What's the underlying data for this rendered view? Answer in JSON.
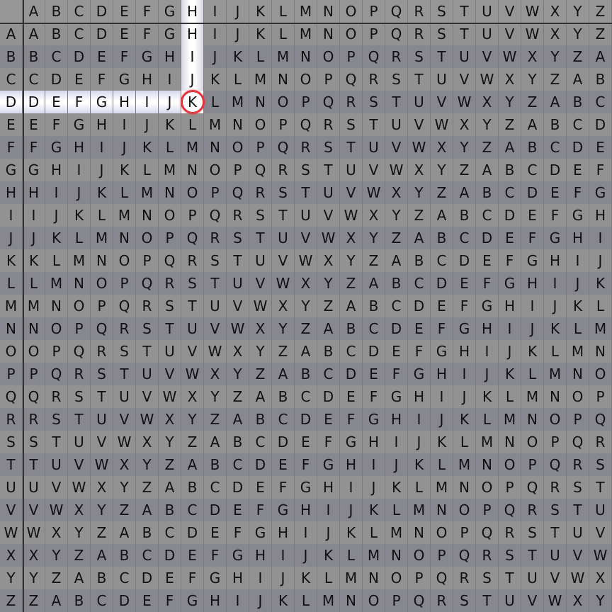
{
  "alphabet": [
    "A",
    "B",
    "C",
    "D",
    "E",
    "F",
    "G",
    "H",
    "I",
    "J",
    "K",
    "L",
    "M",
    "N",
    "O",
    "P",
    "Q",
    "R",
    "S",
    "T",
    "U",
    "V",
    "W",
    "X",
    "Y",
    "Z"
  ],
  "highlight": {
    "row": "D",
    "column": "H",
    "result": "K"
  },
  "colors": {
    "highlight": "#ffffff",
    "ring": "#e8323c",
    "grid_dark": "#333333"
  }
}
